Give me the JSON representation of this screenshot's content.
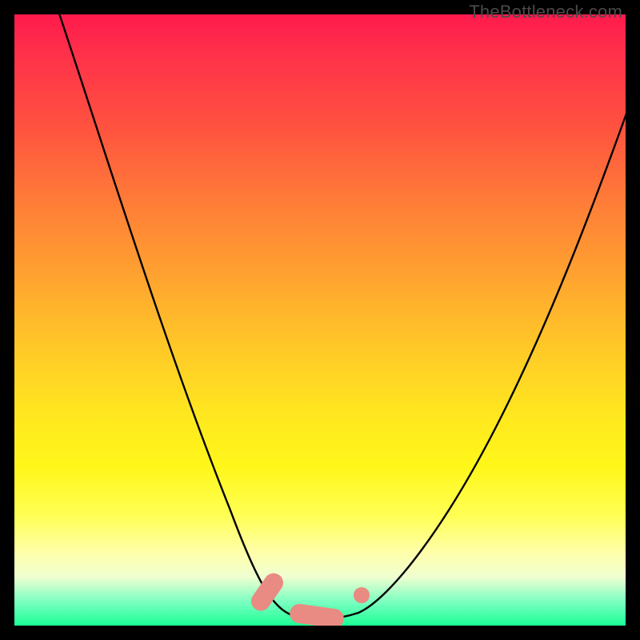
{
  "watermark": "TheBottleneck.com",
  "colors": {
    "frame": "#000000",
    "gradient_stops": [
      "#ff1a4d",
      "#ff5140",
      "#ffa030",
      "#ffe81f",
      "#ffff55",
      "#f0ffd0",
      "#1aff94"
    ],
    "curve": "#000000",
    "marker": "#e98b82"
  },
  "chart_data": {
    "type": "line",
    "title": "",
    "xlabel": "",
    "ylabel": "",
    "xlim": [
      0,
      100
    ],
    "ylim": [
      0,
      100
    ],
    "note": "No axes, ticks, or numeric labels are rendered in the image; x/y values below are estimated from pixel positions on a 0–100 normalized grid (y=100 at top, y=0 at bottom).",
    "series": [
      {
        "name": "bottleneck-curve",
        "x": [
          8,
          12,
          16,
          20,
          24,
          28,
          32,
          36,
          40,
          42,
          44,
          46,
          48,
          50,
          52,
          54,
          56,
          60,
          64,
          68,
          72,
          76,
          80,
          84,
          88,
          92,
          96,
          100
        ],
        "y": [
          100,
          90,
          80,
          70,
          60,
          50,
          40,
          30,
          20,
          14,
          8,
          4,
          2,
          1,
          1,
          1,
          2,
          5,
          10,
          16,
          24,
          32,
          41,
          50,
          60,
          70,
          81,
          92
        ]
      }
    ],
    "markers": [
      {
        "name": "left-pill",
        "shape": "capsule",
        "cx": 42,
        "cy": 5,
        "angle_deg": -55
      },
      {
        "name": "bottom-pill",
        "shape": "capsule",
        "cx": 49,
        "cy": 1,
        "angle_deg": 10
      },
      {
        "name": "right-dot",
        "shape": "circle",
        "cx": 56,
        "cy": 4
      }
    ]
  }
}
